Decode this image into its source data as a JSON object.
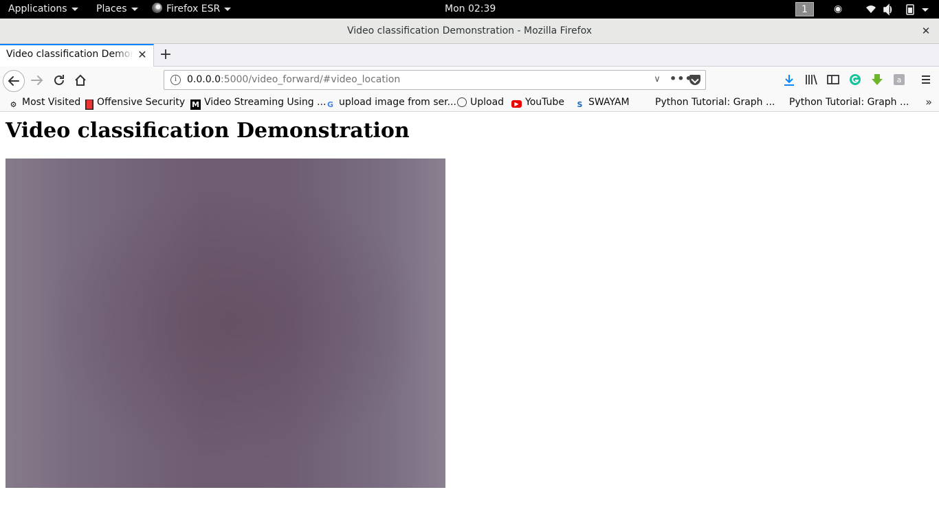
{
  "topbar": {
    "applications": "Applications",
    "places": "Places",
    "browser_app": "Firefox ESR",
    "clock": "Mon 02:39",
    "workspace": "1"
  },
  "window": {
    "title": "Video classification Demonstration - Mozilla Firefox",
    "close": "✕"
  },
  "tab": {
    "title": "Video classification Demonstration",
    "close": "✕",
    "new_tab": "+"
  },
  "urlbar": {
    "host": "0.0.0.0",
    "path": ":5000/video_forward/#video_location"
  },
  "bookmarks": [
    {
      "label": "Most Visited",
      "icon": "gear-icon"
    },
    {
      "label": "Offensive Security",
      "icon": "offsec-icon"
    },
    {
      "label": "Video Streaming Using ...",
      "icon": "medium-icon"
    },
    {
      "label": "upload image from ser...",
      "icon": "google-icon"
    },
    {
      "label": "Upload",
      "icon": "globe-icon"
    },
    {
      "label": "YouTube",
      "icon": "youtube-icon"
    },
    {
      "label": "SWAYAM",
      "icon": "swayam-icon"
    },
    {
      "label": "Python Tutorial: Graph ...",
      "icon": "python-icon"
    },
    {
      "label": "Python Tutorial: Graph ...",
      "icon": "python-icon"
    }
  ],
  "page": {
    "heading": "Video classification Demonstration"
  },
  "colors": {
    "accent": "#0a84ff",
    "video_tint": "#6e5c70"
  }
}
